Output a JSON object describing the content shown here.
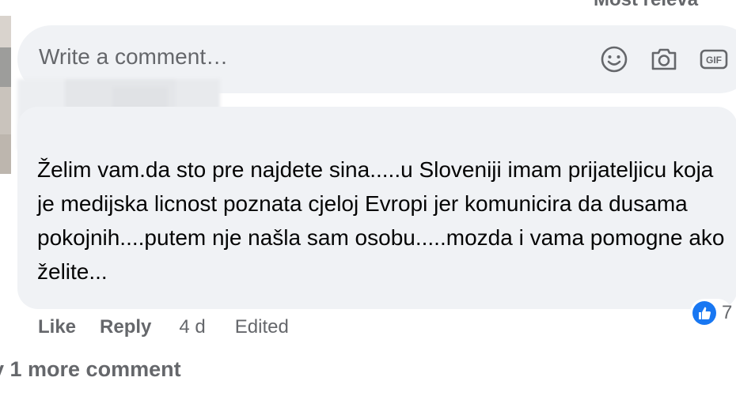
{
  "sort_label": "Most releva",
  "composer": {
    "placeholder": "Write a comment…",
    "icons": [
      "emoji-icon",
      "camera-icon",
      "gif-icon"
    ],
    "gif_label": "GIF"
  },
  "comment": {
    "author": "",
    "text": "Želim vam.da sto pre najdete sina.....u Sloveniji imam prijateljicu koja je medijska licnost poznata cjeloj Evropi jer komunicira da dusama pokojnih....putem nje našla sam osobu.....mozda i vama pomogne ako želite...",
    "reaction_count": "7",
    "actions": {
      "like": "Like",
      "reply": "Reply",
      "time": "4 d",
      "edited": "Edited"
    }
  },
  "more_comments": "v 1 more comment",
  "colors": {
    "bubble": "#f0f2f5",
    "secondary_text": "#65676b",
    "primary_text": "#050505",
    "like_blue": "#1877f2"
  }
}
